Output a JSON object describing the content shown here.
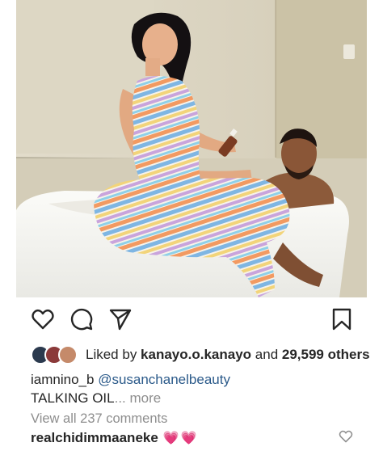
{
  "post": {
    "photo_alt": "",
    "liked_by_prefix": "Liked by ",
    "liked_by_user": "kanayo.o.kanayo",
    "liked_by_and": " and ",
    "liked_by_count": "29,599 others",
    "caption_user": "iamnino_b",
    "caption_mention": "@susanchanelbeauty",
    "caption_text": "TALKING OIL",
    "caption_more": "... more",
    "view_all_comments": "View all 237 comments",
    "comment_user": "realchidimmaaneke",
    "comment_text": "💗💗"
  },
  "icons": {
    "like": "heart-outline-icon",
    "comment": "comment-bubble-icon",
    "share": "paper-plane-icon",
    "save": "bookmark-icon",
    "comment_like": "small-heart-outline-icon"
  },
  "colors": {
    "mention": "#2b5a8a",
    "muted": "#8e8e8e",
    "heart_emoji": "#d8337e"
  }
}
